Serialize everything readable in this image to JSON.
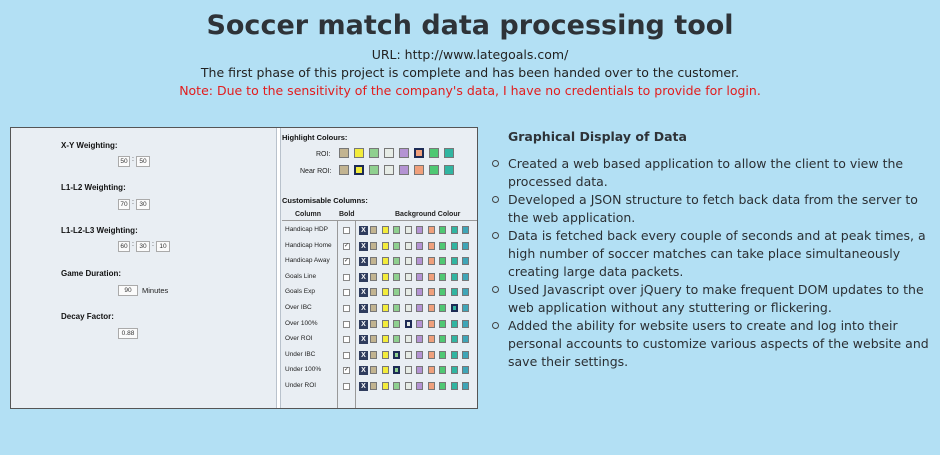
{
  "header": {
    "title": "Soccer match data processing tool",
    "url_line": "URL: http://www.lategoals.com/",
    "phase_line": "The first phase of this project is complete and has been handed over to the customer.",
    "note_line": "Note: Due to the sensitivity of the company's data, I have no credentials to provide for login."
  },
  "screenshot": {
    "left": {
      "xy_label": "X-Y Weighting:",
      "xy_values": [
        "50",
        "50"
      ],
      "l1l2_label": "L1-L2 Weighting:",
      "l1l2_values": [
        "70",
        "30"
      ],
      "l1l2l3_label": "L1-L2-L3 Weighting:",
      "l1l2l3_values": [
        "60",
        "30",
        "10"
      ],
      "duration_label": "Game Duration:",
      "duration_value": "90",
      "duration_unit": "Minutes",
      "decay_label": "Decay Factor:",
      "decay_value": "0.88"
    },
    "right": {
      "highlight_label": "Highlight Colours:",
      "roi_label": "ROI:",
      "near_roi_label": "Near ROI:",
      "palette": [
        "#c2b491",
        "#f3ec3b",
        "#8fd08f",
        "#e6ece6",
        "#b493d3",
        "#f0a07c",
        "#4fc873",
        "#31b5a1"
      ],
      "roi_selected": 5,
      "near_roi_selected": 1,
      "custom_label": "Customisable Columns:",
      "col_header": "Column",
      "bold_header": "Bold",
      "bg_header": "Background Colour",
      "x_mark": "X",
      "check_mark": "✓",
      "rows": [
        {
          "label": "Handicap HDP",
          "bold": false,
          "sel": -1
        },
        {
          "label": "Handicap Home",
          "bold": true,
          "sel": -1
        },
        {
          "label": "Handicap Away",
          "bold": true,
          "sel": -1
        },
        {
          "label": "Goals Line",
          "bold": false,
          "sel": -1
        },
        {
          "label": "Goals Exp",
          "bold": false,
          "sel": -1
        },
        {
          "label": "Over IBC",
          "bold": false,
          "sel": 7
        },
        {
          "label": "Over 100%",
          "bold": false,
          "sel": 3
        },
        {
          "label": "Over ROI",
          "bold": false,
          "sel": -1
        },
        {
          "label": "Under IBC",
          "bold": false,
          "sel": 2
        },
        {
          "label": "Under 100%",
          "bold": true,
          "sel": 2
        },
        {
          "label": "Under ROI",
          "bold": false,
          "sel": -1
        }
      ],
      "matrix_palette": [
        "#c2b491",
        "#f3ec3b",
        "#8fd08f",
        "#e6ece6",
        "#b493d3",
        "#f0a07c",
        "#4fc873",
        "#31b5a1",
        "#3fa5b7"
      ]
    }
  },
  "description": {
    "title": "Graphical Display of Data",
    "bullets": [
      "Created a web based application to allow the client to view the processed data.",
      "Developed a JSON structure to fetch back data from the server to the web application.",
      "Data is fetched back every couple of seconds and at peak times, a high number of soccer matches can take place simultaneously creating large data packets.",
      "Used Javascript over jQuery to make frequent DOM updates to the web application without any stuttering or flickering.",
      "Added the ability for website users to create and log into their personal accounts to customize various aspects of the website and save their settings."
    ]
  }
}
